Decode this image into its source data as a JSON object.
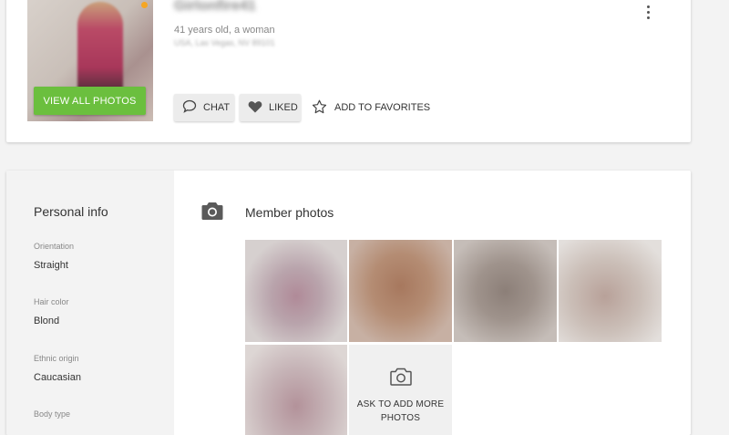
{
  "profile": {
    "username": "Girlonfire41",
    "age_line": "41 years old, a woman",
    "location_line": "USA, Las Vegas, NV 89101",
    "view_all_label": "VIEW ALL PHOTOS",
    "online_color": "#f5a623"
  },
  "actions": {
    "chat_label": "CHAT",
    "liked_label": "LIKED",
    "favorites_label": "ADD TO FAVORITES"
  },
  "personal_info": {
    "title": "Personal info",
    "items": [
      {
        "label": "Orientation",
        "value": "Straight"
      },
      {
        "label": "Hair color",
        "value": "Blond"
      },
      {
        "label": "Ethnic origin",
        "value": "Caucasian"
      },
      {
        "label": "Body type",
        "value": ""
      }
    ]
  },
  "photos": {
    "title": "Member photos",
    "ask_label_line1": "ASK TO ADD MORE",
    "ask_label_line2": "PHOTOS"
  },
  "colors": {
    "accent_green": "#6bbf3e",
    "page_bg": "#f3f3f3"
  }
}
